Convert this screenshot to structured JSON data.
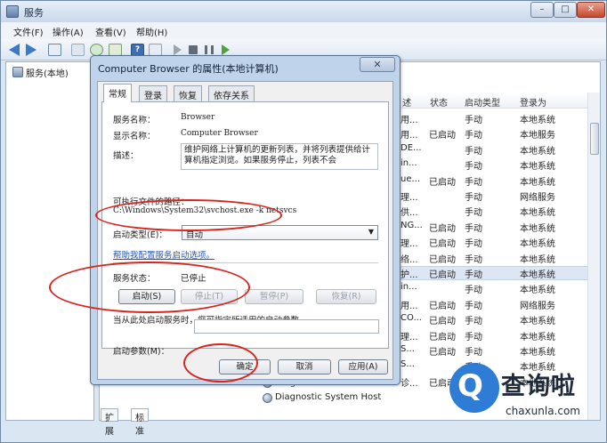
{
  "window": {
    "title": "服务",
    "menu": [
      "文件(F)",
      "操作(A)",
      "查看(V)",
      "帮助(H)"
    ],
    "min_glyph": "–",
    "max_glyph": "□",
    "close_glyph": "✕"
  },
  "tree": {
    "root": "服务(本地)"
  },
  "list": {
    "columns": [
      "述",
      "状态",
      "启动类型",
      "登录为"
    ],
    "rows": [
      {
        "desc": "用...",
        "status": "",
        "startup": "手动",
        "logon": "本地系统"
      },
      {
        "desc": "用...",
        "status": "已启动",
        "startup": "手动",
        "logon": "本地服务"
      },
      {
        "desc": "DE...",
        "status": "",
        "startup": "手动",
        "logon": "本地系统"
      },
      {
        "desc": "in...",
        "status": "",
        "startup": "手动",
        "logon": "本地系统"
      },
      {
        "desc": "ue...",
        "status": "已启动",
        "startup": "手动",
        "logon": "本地系统"
      },
      {
        "desc": "理...",
        "status": "",
        "startup": "手动",
        "logon": "网络服务"
      },
      {
        "desc": "供...",
        "status": "",
        "startup": "手动",
        "logon": "本地系统"
      },
      {
        "desc": "NG...",
        "status": "已启动",
        "startup": "手动",
        "logon": "本地系统"
      },
      {
        "desc": "理...",
        "status": "已启动",
        "startup": "手动",
        "logon": "本地系统"
      },
      {
        "desc": "络...",
        "status": "已启动",
        "startup": "手动",
        "logon": "本地系统"
      },
      {
        "desc": "护...",
        "status": "已启动",
        "startup": "手动",
        "logon": "本地系统"
      },
      {
        "desc": "in...",
        "status": "",
        "startup": "手动",
        "logon": "本地系统"
      },
      {
        "desc": "用...",
        "status": "已启动",
        "startup": "手动",
        "logon": "网络服务"
      },
      {
        "desc": "CO...",
        "status": "已启动",
        "startup": "手动",
        "logon": "本地系统"
      },
      {
        "desc": "理...",
        "status": "已启动",
        "startup": "手动",
        "logon": "本地系统"
      },
      {
        "desc": "S...",
        "status": "已启动",
        "startup": "手动",
        "logon": "本地系统"
      },
      {
        "desc": "S...",
        "status": "",
        "startup": "手动",
        "logon": "本地系统"
      },
      {
        "desc": "诊...",
        "status": "已启动",
        "startup": "手动",
        "logon": "本地系统"
      }
    ],
    "bottom_items": [
      "Diagnostic Service Host",
      "Diagnostic System Host"
    ],
    "bottom_tabs": [
      "扩展",
      "标准"
    ]
  },
  "dialog": {
    "title": "Computer Browser 的属性(本地计算机)",
    "close_glyph": "✕",
    "tabs": [
      "常规",
      "登录",
      "恢复",
      "依存关系"
    ],
    "service_name_label": "服务名称：",
    "service_name": "Browser",
    "display_name_label": "显示名称：",
    "display_name": "Computer Browser",
    "description_label": "描述：",
    "description": "维护网络上计算机的更新列表，并将列表提供给计算机指定浏览。如果服务停止，列表不会",
    "path_label": "可执行文件的路径：",
    "path": "C:\\Windows\\System32\\svchost.exe -k netsvcs",
    "startup_type_label": "启动类型(E)：",
    "startup_type": "自动",
    "help_link": "帮助我配置服务启动选项。",
    "status_label": "服务状态：",
    "status": "已停止",
    "start_btn": "启动(S)",
    "stop_btn": "停止(T)",
    "pause_btn": "暂停(P)",
    "resume_btn": "恢复(R)",
    "hint": "当从此处启动服务时，您可指定所适用的启动参数。",
    "param_label": "启动参数(M)：",
    "ok_btn": "确定",
    "cancel_btn": "取消",
    "apply_btn": "应用(A)"
  },
  "watermark": {
    "glyph": "Q",
    "title": "查询啦",
    "url": "chaxunla.com"
  },
  "colors": {
    "annotation_red": "#d8251d",
    "link_blue": "#2457b8",
    "watermark_blue": "#2f7cd6"
  }
}
